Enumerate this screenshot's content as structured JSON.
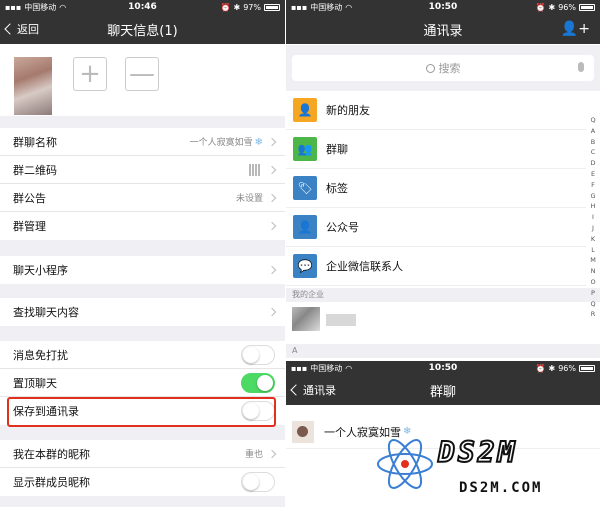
{
  "left_screen": {
    "status": {
      "carrier": "中国移动",
      "time": "10:46",
      "battery": "97%",
      "battery_level": 0.97
    },
    "nav": {
      "back_label": "返回",
      "title": "聊天信息(1)"
    },
    "members": {
      "add_symbol": "+",
      "remove_symbol": "—"
    },
    "settings_group1": [
      {
        "label": "群聊名称",
        "value": "一个人寂寞如雪"
      },
      {
        "label": "群二维码",
        "value": ""
      },
      {
        "label": "群公告",
        "value": "未设置"
      },
      {
        "label": "群管理",
        "value": ""
      }
    ],
    "settings_group2": [
      {
        "label": "聊天小程序"
      }
    ],
    "settings_group3": [
      {
        "label": "查找聊天内容"
      }
    ],
    "settings_group4": [
      {
        "label": "消息免打扰",
        "on": false
      },
      {
        "label": "置顶聊天",
        "on": true
      },
      {
        "label": "保存到通讯录",
        "on": false
      }
    ],
    "settings_group5": [
      {
        "label": "我在本群的昵称",
        "value": "重也"
      },
      {
        "label": "显示群成员昵称",
        "on": false
      }
    ]
  },
  "right_screen": {
    "status": {
      "carrier": "中国移动",
      "time": "10:50",
      "battery": "96%",
      "battery_level": 0.96
    },
    "nav": {
      "title": "通讯录"
    },
    "search": {
      "placeholder": "搜索"
    },
    "contacts": [
      {
        "label": "新的朋友",
        "icon": "add-friend-icon",
        "color": "#f5a623"
      },
      {
        "label": "群聊",
        "icon": "group-chat-icon",
        "color": "#4cb648"
      },
      {
        "label": "标签",
        "icon": "tag-icon",
        "color": "#3a82c4"
      },
      {
        "label": "公众号",
        "icon": "official-account-icon",
        "color": "#3a82c4"
      },
      {
        "label": "企业微信联系人",
        "icon": "enterprise-contact-icon",
        "color": "#3a82c4"
      }
    ],
    "section_my_company": "我的企业",
    "section_a": "A",
    "index_letters": [
      "Q",
      "A",
      "B",
      "C",
      "D",
      "E",
      "F",
      "G",
      "H",
      "I",
      "J",
      "K",
      "L",
      "M",
      "N",
      "O",
      "P",
      "Q",
      "R"
    ]
  },
  "bottom_right_screen": {
    "status": {
      "carrier": "中国移动",
      "time": "10:50",
      "battery": "96%",
      "battery_level": 0.96
    },
    "nav": {
      "back_label": "通讯录",
      "title": "群聊"
    },
    "group_chat": {
      "name": "一个人寂寞如雪"
    }
  },
  "watermark": {
    "brand": "DS2M",
    "domain": "DS2M.COM"
  }
}
